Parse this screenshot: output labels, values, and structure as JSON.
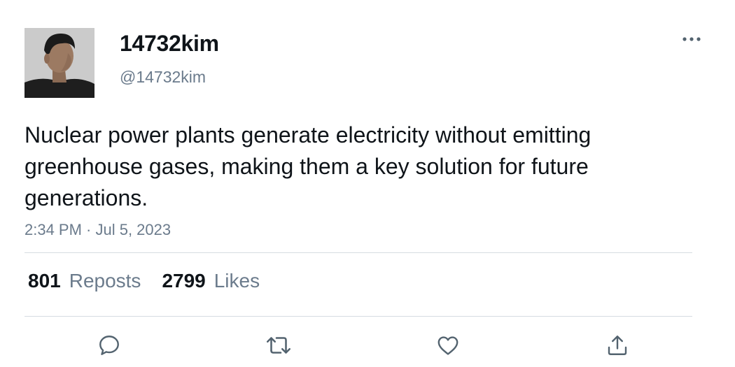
{
  "user": {
    "display_name": "14732kim",
    "handle": "@14732kim"
  },
  "tweet": {
    "text": "Nuclear power plants generate electricity without emitting greenhouse gases, making them a key solution for future generations.",
    "timestamp": "2:34 PM · Jul 5, 2023"
  },
  "stats": {
    "reposts_count": "801",
    "reposts_label": "Reposts",
    "likes_count": "2799",
    "likes_label": "Likes"
  },
  "icons": {
    "more": "more-horizontal-icon",
    "reply": "reply-icon",
    "repost": "repost-icon",
    "like": "heart-icon",
    "share": "share-icon"
  },
  "colors": {
    "text_primary": "#0f1419",
    "text_secondary": "#6b7b8c",
    "divider": "#d6dce1",
    "icon": "#53636f"
  }
}
